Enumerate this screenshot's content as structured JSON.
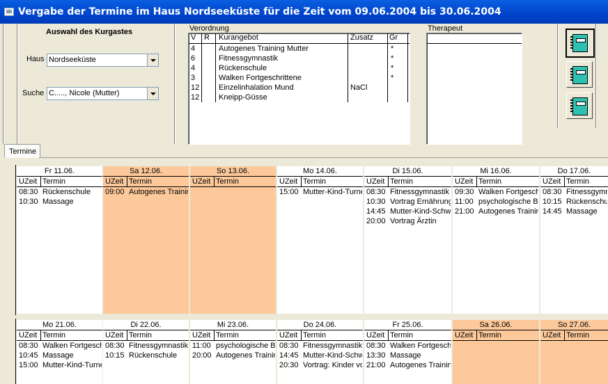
{
  "window": {
    "title": "Vergabe der Termine im Haus Nordseeküste für die Zeit vom 09.06.2004 bis 30.06.2004"
  },
  "guest": {
    "heading": "Auswahl des Kurgastes",
    "haus_label": "Haus",
    "haus_value": "Nordseeküste",
    "suche_label": "Suche",
    "suche_value": "C....., Nicole (Mutter)"
  },
  "verordnung": {
    "title": "Verordnung",
    "columns": [
      "V",
      "R",
      "Kurangebot",
      "Zusatz",
      "Gr"
    ],
    "rows": [
      {
        "v": "4",
        "r": "",
        "kurangebot": "Autogenes Training Mutter",
        "zusatz": "",
        "gr": "*"
      },
      {
        "v": "6",
        "r": "",
        "kurangebot": "Fitnessgymnastik",
        "zusatz": "",
        "gr": "*"
      },
      {
        "v": "4",
        "r": "",
        "kurangebot": "Rückenschule",
        "zusatz": "",
        "gr": "*"
      },
      {
        "v": "3",
        "r": "",
        "kurangebot": "Walken Fortgeschrittene",
        "zusatz": "",
        "gr": "*"
      },
      {
        "v": "12",
        "r": "",
        "kurangebot": "Einzelinhalation Mund",
        "zusatz": "NaCl",
        "gr": ""
      },
      {
        "v": "12",
        "r": "",
        "kurangebot": "Kneipp-Güsse",
        "zusatz": "",
        "gr": ""
      }
    ]
  },
  "therapeut": {
    "title": "Therapeut"
  },
  "tabs": [
    {
      "label": "Termine"
    }
  ],
  "colors": {
    "weekend": "#fdc99b",
    "titlebar": "#0054e3",
    "background": "#ece9d8"
  },
  "day_columns": {
    "time": "UZeit",
    "term": "Termin"
  },
  "week1": [
    {
      "head": "Fr   11.06.",
      "weekend": false,
      "entries": [
        {
          "t": "08:30",
          "n": "Rückenschule"
        },
        {
          "t": "10:30",
          "n": "Massage"
        }
      ]
    },
    {
      "head": "Sa   12.06.",
      "weekend": true,
      "entries": [
        {
          "t": "09:00",
          "n": "Autogenes Training"
        }
      ]
    },
    {
      "head": "So   13.06.",
      "weekend": true,
      "entries": []
    },
    {
      "head": "Mo   14.06.",
      "weekend": false,
      "entries": [
        {
          "t": "15:00",
          "n": "Mutter-Kind-Turnen"
        }
      ]
    },
    {
      "head": "Di   15.06.",
      "weekend": false,
      "entries": [
        {
          "t": "08:30",
          "n": "Fitnessgymnastik"
        },
        {
          "t": "10:30",
          "n": "Vortrag Ernährung"
        },
        {
          "t": "14:45",
          "n": "Mutter-Kind-Schwimmen"
        },
        {
          "t": "20:00",
          "n": "Vortrag Ärztin"
        }
      ]
    },
    {
      "head": "Mi   16.06.",
      "weekend": false,
      "entries": [
        {
          "t": "09:30",
          "n": "Walken Fortgeschrittene"
        },
        {
          "t": "11:00",
          "n": "psychologische Beratung"
        },
        {
          "t": "21:00",
          "n": "Autogenes Training"
        }
      ]
    },
    {
      "head": "Do   17.06.",
      "weekend": false,
      "entries": [
        {
          "t": "08:30",
          "n": "Fitnessgymnastik"
        },
        {
          "t": "10:15",
          "n": "Rückenschule"
        },
        {
          "t": "14:45",
          "n": "Massage"
        }
      ]
    }
  ],
  "week2": [
    {
      "head": "Mo   21.06.",
      "weekend": false,
      "entries": [
        {
          "t": "08:30",
          "n": "Walken Fortgeschrittene"
        },
        {
          "t": "10:45",
          "n": "Massage"
        },
        {
          "t": "15:00",
          "n": "Mutter-Kind-Turnen"
        }
      ]
    },
    {
      "head": "Di   22.06.",
      "weekend": false,
      "entries": [
        {
          "t": "08:30",
          "n": "Fitnessgymnastik"
        },
        {
          "t": "10:15",
          "n": "Rückenschule"
        }
      ]
    },
    {
      "head": "Mi   23.06.",
      "weekend": false,
      "entries": [
        {
          "t": "11:00",
          "n": "psychologische Beratung"
        },
        {
          "t": "20:00",
          "n": "Autogenes Training"
        }
      ]
    },
    {
      "head": "Do   24.06.",
      "weekend": false,
      "entries": [
        {
          "t": "08:30",
          "n": "Fitnessgymnastik"
        },
        {
          "t": "14:45",
          "n": "Mutter-Kind-Schwimmen"
        },
        {
          "t": "20:30",
          "n": "Vortrag: Kinder von"
        }
      ]
    },
    {
      "head": "Fr   25.06.",
      "weekend": false,
      "entries": [
        {
          "t": "08:30",
          "n": "Walken Fortgeschrittene"
        },
        {
          "t": "13:30",
          "n": "Massage"
        },
        {
          "t": "21:00",
          "n": "Autogenes Training"
        }
      ]
    },
    {
      "head": "Sa   26.06.",
      "weekend": true,
      "entries": []
    },
    {
      "head": "So   27.06.",
      "weekend": true,
      "entries": []
    }
  ]
}
